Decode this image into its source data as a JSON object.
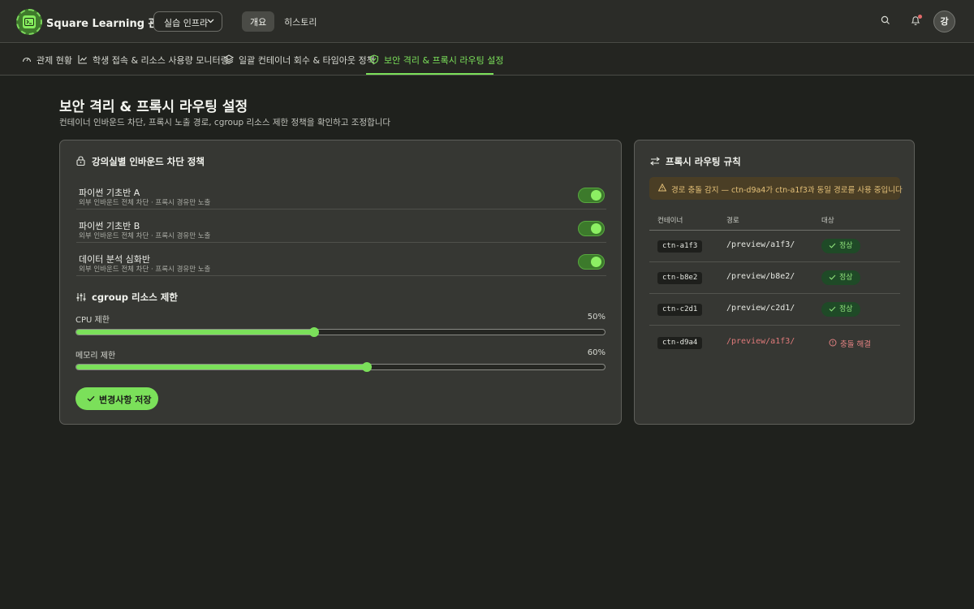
{
  "header": {
    "app_title": "Square Learning 관제",
    "infra_select": "실습 인프라",
    "nav": [
      "개요",
      "히스토리"
    ],
    "avatar_initial": "강"
  },
  "subnav": {
    "tabs": [
      {
        "label": "관제 현황",
        "icon": "gauge-icon"
      },
      {
        "label": "학생 접속 & 리소스 사용량 모니터링",
        "icon": "line-chart-icon"
      },
      {
        "label": "일괄 컨테이너 회수 & 타임아웃 정책",
        "icon": "layers-icon"
      },
      {
        "label": "보안 격리 & 프록시 라우팅 설정",
        "icon": "shield-check-icon",
        "active": true
      }
    ]
  },
  "page": {
    "title": "보안 격리 & 프록시 라우팅 설정",
    "subtitle": "컨테이너 인바운드 차단, 프록시 노출 경로, cgroup 리소스 제한 정책을 확인하고 조정합니다"
  },
  "inbound": {
    "title": "강의실별 인바운드 차단 정책",
    "policies": [
      {
        "name": "파이썬 기초반 A",
        "desc": "외부 인바운드 전체 차단 · 프록시 경유만 노출",
        "enabled": true
      },
      {
        "name": "파이썬 기초반 B",
        "desc": "외부 인바운드 전체 차단 · 프록시 경유만 노출",
        "enabled": true
      },
      {
        "name": "데이터 분석 심화반",
        "desc": "외부 인바운드 전체 차단 · 프록시 경유만 노출",
        "enabled": true
      }
    ]
  },
  "cgroup": {
    "title": "cgroup 리소스 제한",
    "cpu_label": "CPU 제한",
    "cpu_value": "50%",
    "cpu_fraction": 0.45,
    "mem_label": "메모리 제한",
    "mem_value": "60%",
    "mem_fraction": 0.55,
    "save_label": "변경사항 저장"
  },
  "proxy": {
    "title": "프록시 라우팅 규칙",
    "alert": "경로 충돌 감지 — ctn-d9a4가 ctn-a1f3과 동일 경로를 사용 중입니다",
    "columns": [
      "컨테이너",
      "경로",
      "대상"
    ],
    "rows": [
      {
        "container": "ctn-a1f3",
        "path": "/preview/a1f3/",
        "status": "정상",
        "ok": true
      },
      {
        "container": "ctn-b8e2",
        "path": "/preview/b8e2/",
        "status": "정상",
        "ok": true
      },
      {
        "container": "ctn-c2d1",
        "path": "/preview/c2d1/",
        "status": "정상",
        "ok": true
      },
      {
        "container": "ctn-d9a4",
        "path": "/preview/a1f3/",
        "status": "충돌 해결",
        "ok": false
      }
    ]
  },
  "colors": {
    "accent": "#7be05a",
    "warning": "#e4c078",
    "danger": "#e07a7a"
  }
}
